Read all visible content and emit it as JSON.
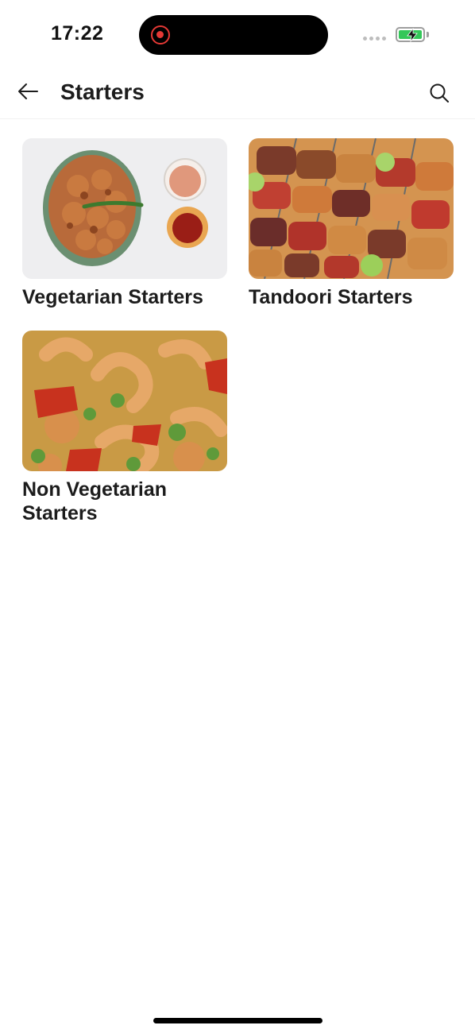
{
  "status_bar": {
    "time": "17:22",
    "battery_color": "#34c759",
    "recording_color": "#e53935"
  },
  "header": {
    "title": "Starters",
    "back_icon": "arrow-left-icon",
    "search_icon": "search-icon"
  },
  "categories": [
    {
      "title": "Vegetarian Starters",
      "image": "pakora-bowl-with-dips"
    },
    {
      "title": "Tandoori Starters",
      "image": "chicken-tikka-skewers"
    },
    {
      "title": "Non Vegetarian Starters",
      "image": "prawn-curry-with-peas"
    }
  ]
}
